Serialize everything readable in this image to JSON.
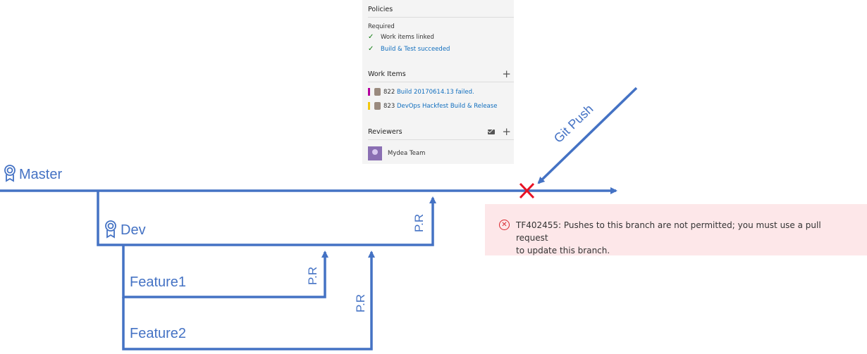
{
  "colors": {
    "line": "#4472c4",
    "reject": "#e81123",
    "error_bg": "#fde7e9"
  },
  "panel": {
    "policies": {
      "title": "Policies",
      "required_label": "Required",
      "items": [
        "Work items linked",
        "Build & Test succeeded"
      ]
    },
    "work_items": {
      "title": "Work Items",
      "items": [
        {
          "id": "822",
          "text": "Build 20170614.13 failed.",
          "color": "#b4009e"
        },
        {
          "id": "823",
          "text": "DevOps Hackfest Build & Release",
          "color": "#f2c80f"
        }
      ]
    },
    "reviewers": {
      "title": "Reviewers",
      "items": [
        "Mydea Team"
      ]
    }
  },
  "diagram": {
    "branches": {
      "master": "Master",
      "dev": "Dev",
      "feature1": "Feature1",
      "feature2": "Feature2"
    },
    "pr_label": "P.R",
    "git_push": "Git Push"
  },
  "error": {
    "code_line": "TF402455: Pushes to this branch are not permitted; you must use a pull request",
    "cont_line": "to update this branch."
  }
}
